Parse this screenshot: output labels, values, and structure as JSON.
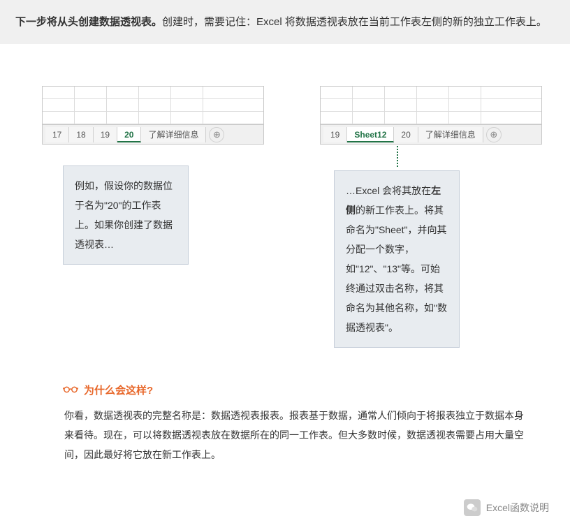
{
  "header": {
    "bold_part": "下一步将从头创建数据透视表。",
    "rest": "创建时，需要记住：Excel 将数据透视表放在当前工作表左侧的新的独立工作表上。"
  },
  "left_mock": {
    "tabs": [
      "17",
      "18",
      "19",
      "20",
      "了解详细信息"
    ],
    "active_index": 3
  },
  "right_mock": {
    "tabs": [
      "19",
      "Sheet12",
      "20",
      "了解详细信息"
    ],
    "active_index": 1
  },
  "caption_left": "例如，假设你的数据位于名为\"20\"的工作表上。如果你创建了数据透视表…",
  "caption_right": {
    "p1": "…Excel 会将其放在",
    "b1": "左侧",
    "p2": "的新工作表上。将其命名为\"Sheet\"，并向其分配一个数字，如\"12\"、\"13\"等。可始终通过双击名称，将其命名为其他名称，如\"数据透视表\"。"
  },
  "why": {
    "title": "为什么会这样?",
    "body": "你看，数据透视表的完整名称是：数据透视表报表。报表基于数据，通常人们倾向于将报表独立于数据本身来看待。现在，可以将数据透视表放在数据所在的同一工作表。但大多数时候，数据透视表需要占用大量空间，因此最好将它放在新工作表上。"
  },
  "footer": {
    "label": "Excel函数说明"
  }
}
